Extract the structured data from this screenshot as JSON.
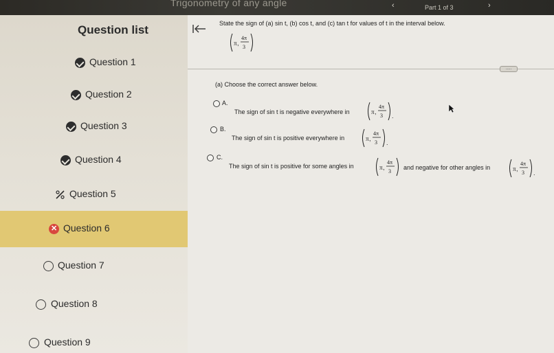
{
  "topbar": {
    "title": "Trigonometry of any angle",
    "part_text": "Part 1 of 3"
  },
  "sidebar": {
    "header": "Question list",
    "items": [
      {
        "label": "Question 1",
        "status": "answered"
      },
      {
        "label": "Question 2",
        "status": "answered"
      },
      {
        "label": "Question 3",
        "status": "answered"
      },
      {
        "label": "Question 4",
        "status": "answered"
      },
      {
        "label": "Question 5",
        "status": "partial"
      },
      {
        "label": "Question 6",
        "status": "incorrect",
        "active": true
      },
      {
        "label": "Question 7",
        "status": "unanswered"
      },
      {
        "label": "Question 8",
        "status": "unanswered"
      },
      {
        "label": "Question 9",
        "status": "unanswered"
      }
    ]
  },
  "question": {
    "prompt": "State the sign of (a) sin t, (b) cos t, and (c) tan t for values of t in the interval below.",
    "interval": {
      "left": "π",
      "num": "4π",
      "den": "3"
    },
    "part_a_instruction": "(a) Choose the correct answer below.",
    "choices": [
      {
        "letter": "A.",
        "text": "The sign of sin t is negative everywhere in",
        "suffix": "."
      },
      {
        "letter": "B.",
        "text": "The sign of sin t is positive everywhere in",
        "suffix": "."
      },
      {
        "letter": "C.",
        "text": "The sign of sin t is positive for some angles in",
        "middle": "and negative for other angles in",
        "suffix": "."
      }
    ],
    "more_button": "....."
  },
  "colors": {
    "active_row": "#e1c873",
    "incorrect": "#d8473e",
    "answered": "#2d2d2d"
  }
}
